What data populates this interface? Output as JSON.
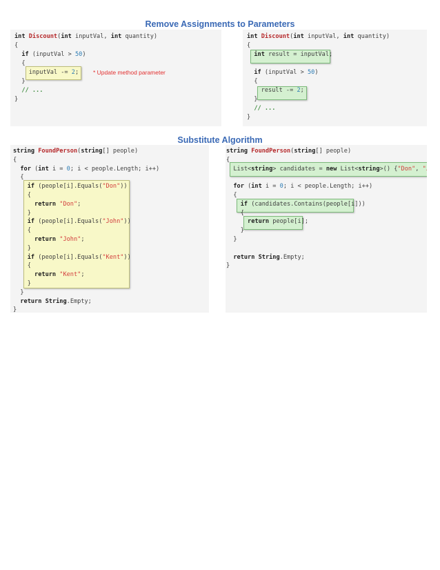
{
  "sections": {
    "remove_assignments": {
      "title": "Remove Assignments to Parameters",
      "note": "* Update method parameter"
    },
    "substitute_algorithm": {
      "title": "Substitute Algorithm"
    }
  },
  "code": {
    "discount_before": [
      "int Discount(int inputVal, int quantity)",
      "{",
      "  if (inputVal > 50)",
      "  {",
      "    inputVal -= 2;",
      "  }",
      "  // ...",
      "}"
    ],
    "discount_after": [
      "int Discount(int inputVal, int quantity)",
      "{",
      "  int result = inputVal;",
      "",
      "  if (inputVal > 50)",
      "  {",
      "    result -= 2;",
      "  }",
      "  // ...",
      "}"
    ],
    "found_before": [
      "string FoundPerson(string[] people)",
      "{",
      "  for (int i = 0; i < people.Length; i++)",
      "  {",
      "    if (people[i].Equals(\"Don\"))",
      "    {",
      "      return \"Don\";",
      "    }",
      "    if (people[i].Equals(\"John\"))",
      "    {",
      "      return \"John\";",
      "    }",
      "    if (people[i].Equals(\"Kent\"))",
      "    {",
      "      return \"Kent\";",
      "    }",
      "  }",
      "  return String.Empty;",
      "}"
    ],
    "found_after": [
      "string FoundPerson(string[] people)",
      "{",
      "  List<string> candidates = new List<string>() {\"Don\", \"John\", \"",
      "",
      "  for (int i = 0; i < people.Length; i++)",
      "  {",
      "    if (candidates.Contains(people[i]))",
      "    {",
      "      return people[i];",
      "    }",
      "  }",
      "",
      "  return String.Empty;",
      "}"
    ]
  },
  "colors": {
    "title": "#3a69b5",
    "keyword": "#202020",
    "function": "#b5282a",
    "number": "#2e7db5",
    "string": "#d23b3b",
    "comment": "#3a8a3a",
    "note": "#e23030",
    "highlight_yellow": "#f8f8c8",
    "highlight_green": "#d4f0d0"
  }
}
